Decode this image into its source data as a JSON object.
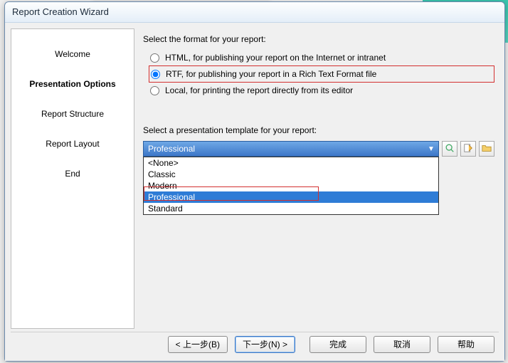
{
  "window": {
    "title": "Report Creation Wizard"
  },
  "sidebar": {
    "items": [
      {
        "label": "Welcome"
      },
      {
        "label": "Presentation Options"
      },
      {
        "label": "Report Structure"
      },
      {
        "label": "Report Layout"
      },
      {
        "label": "End"
      }
    ],
    "active_index": 1
  },
  "format": {
    "prompt": "Select the format for your report:",
    "options": [
      {
        "label": "HTML, for publishing your report on the Internet or intranet",
        "selected": false
      },
      {
        "label": "RTF, for publishing your report in a Rich Text Format file",
        "selected": true
      },
      {
        "label": "Local, for printing the report directly from its editor",
        "selected": false
      }
    ]
  },
  "template": {
    "prompt": "Select a presentation template for your report:",
    "selected": "Professional",
    "options": [
      {
        "label": "<None>"
      },
      {
        "label": "Classic"
      },
      {
        "label": "Modern"
      },
      {
        "label": "Professional"
      },
      {
        "label": "Standard"
      }
    ],
    "highlighted_index": 3,
    "icons": {
      "preview": "preview-icon",
      "edit": "edit-icon",
      "browse": "folder-icon"
    }
  },
  "buttons": {
    "back": "< 上一步(B)",
    "next": "下一步(N) >",
    "finish": "完成",
    "cancel": "取消",
    "help": "帮助"
  }
}
